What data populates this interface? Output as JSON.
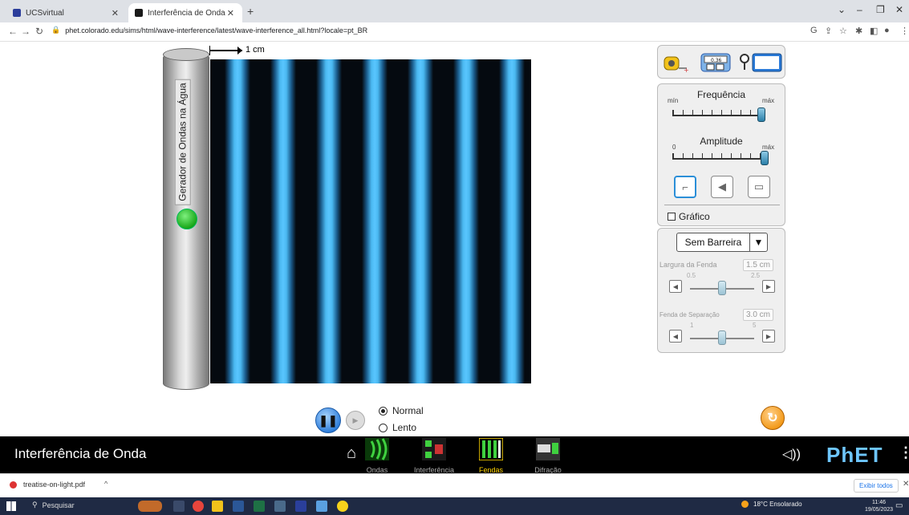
{
  "browser": {
    "tabs": [
      {
        "label": "UCSvirtual",
        "favicon_color": "#2b3d9b"
      },
      {
        "label": "Interferência de Onda",
        "favicon_color": "#1a1a1a"
      }
    ],
    "new_tab": "+",
    "url": "phet.colorado.edu/sims/html/wave-interference/latest/wave-interference_all.html?locale=pt_BR"
  },
  "sim": {
    "ruler_label": "1 cm",
    "generator_label": "Gerador de Ondas na Água",
    "frequency": {
      "title": "Frequência",
      "min_label": "mín",
      "max_label": "máx",
      "value_fraction": 1.0
    },
    "amplitude": {
      "title": "Amplitude",
      "min_label": "0",
      "max_label": "máx",
      "value_fraction": 1.0
    },
    "graph_checkbox_label": "Gráfico",
    "barrier_dropdown": "Sem Barreira",
    "slit_width": {
      "label": "Largura da Fenda",
      "value": "1.5 cm",
      "min": "0.5",
      "max": "2.5"
    },
    "slit_separation": {
      "label": "Fenda de Separação",
      "value": "3.0 cm",
      "min": "1",
      "max": "5"
    },
    "speed_normal": "Normal",
    "speed_slow": "Lento",
    "tool_meter_value": "0.36"
  },
  "navbar": {
    "title": "Interferência de Onda",
    "screens": [
      {
        "label": "Ondas",
        "active": false
      },
      {
        "label": "Interferência",
        "active": false
      },
      {
        "label": "Fendas",
        "active": true
      },
      {
        "label": "Difração",
        "active": false
      }
    ],
    "logo": "PhET"
  },
  "downloads": {
    "file": "treatise-on-light.pdf",
    "show_all": "Exibir todos"
  },
  "taskbar": {
    "search_placeholder": "Pesquisar",
    "weather": "18°C Ensolarado",
    "time": "11:46",
    "date": "19/05/2023"
  },
  "colors": {
    "wave_bright": "#59c6ff",
    "wave_dark": "#050a10",
    "accent": "#2b8fd8",
    "active_screen": "#ffd400"
  }
}
